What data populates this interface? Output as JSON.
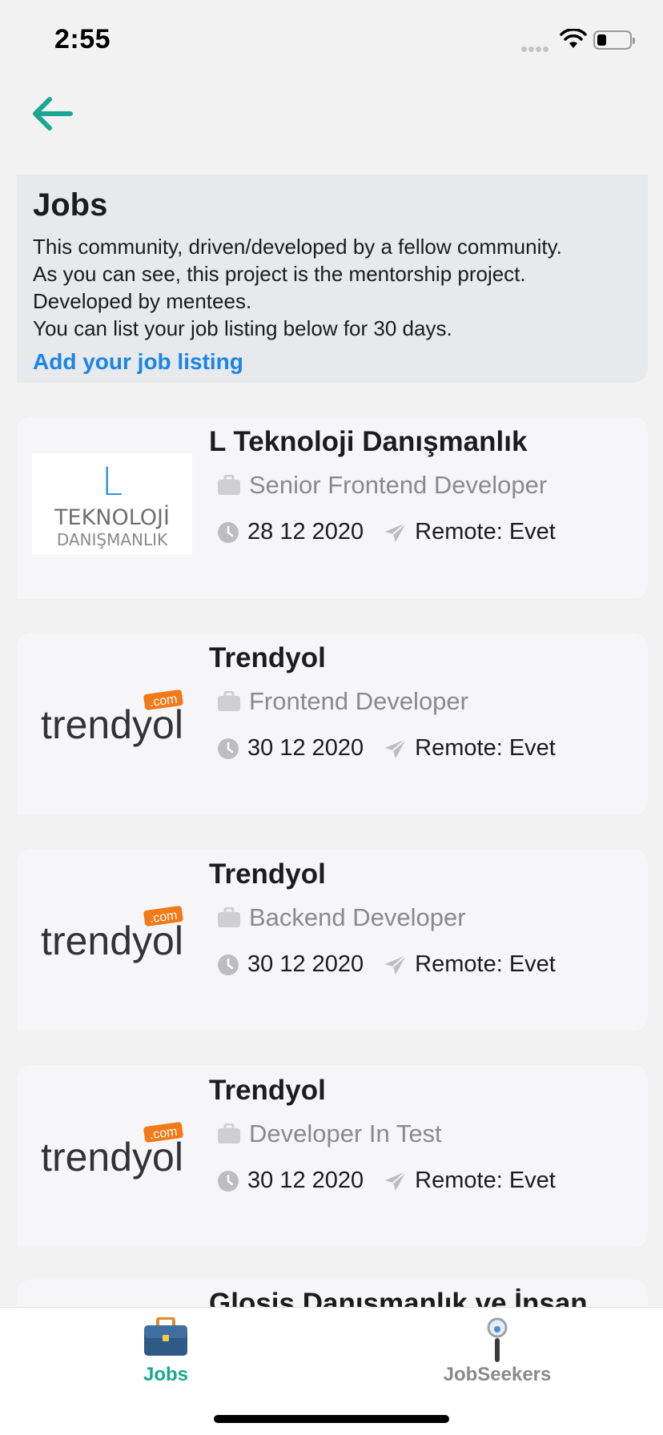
{
  "status_bar": {
    "time": "2:55",
    "battery_level": 0.3
  },
  "intro": {
    "title": "Jobs",
    "lines": [
      "This community, driven/developed by a fellow community.",
      "As you can see, this project is the mentorship project.",
      "Developed by mentees.",
      "You can list your job listing below for 30 days."
    ],
    "add_link": "Add your job listing"
  },
  "jobs": [
    {
      "company": "L Teknoloji Danışmanlık",
      "position": "Senior Frontend Developer",
      "date": "28 12 2020",
      "remote": "Remote: Evet",
      "logo": {
        "top": "L",
        "middle": "TEKNOLOJİ",
        "bottom": "DANIŞMANLIK"
      }
    },
    {
      "company": "Trendyol",
      "position": "Frontend Developer",
      "date": "30 12 2020",
      "remote": "Remote: Evet",
      "logo": {
        "word": "trendyol",
        "badge": ".com"
      }
    },
    {
      "company": "Trendyol",
      "position": "Backend Developer",
      "date": "30 12 2020",
      "remote": "Remote: Evet",
      "logo": {
        "word": "trendyol",
        "badge": ".com"
      }
    },
    {
      "company": "Trendyol",
      "position": "Developer In Test",
      "date": "30 12 2020",
      "remote": "Remote: Evet",
      "logo": {
        "word": "trendyol",
        "badge": ".com"
      }
    },
    {
      "company": "Glosis Danışmanlık ve İnsan"
    }
  ],
  "tabs": [
    {
      "label": "Jobs",
      "active": true,
      "icon": "briefcase-icon"
    },
    {
      "label": "JobSeekers",
      "active": false,
      "icon": "magnifier-icon"
    }
  ],
  "colors": {
    "accent": "#1aa693",
    "link": "#1a84ea",
    "trendyol_orange": "#f27a1a"
  }
}
